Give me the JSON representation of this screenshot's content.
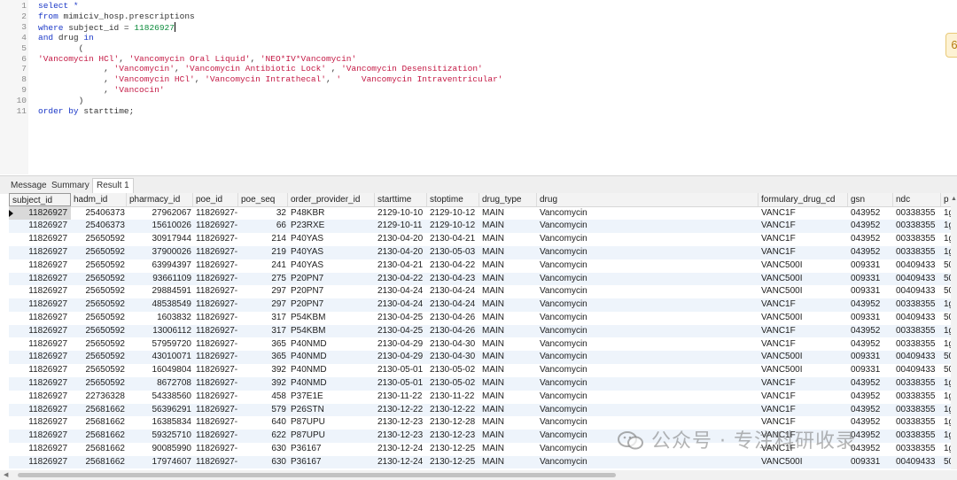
{
  "editor": {
    "line_numbers": [
      "1",
      "2",
      "3",
      "4",
      "5",
      "6",
      "7",
      "8",
      "9",
      "10",
      "11"
    ],
    "lines": [
      [
        {
          "t": "select *",
          "c": "kw"
        }
      ],
      [
        {
          "t": "from ",
          "c": "kw"
        },
        {
          "t": "mimiciv_hosp.prescriptions",
          "c": ""
        }
      ],
      [
        {
          "t": "where ",
          "c": "kw"
        },
        {
          "t": "subject_id = ",
          "c": ""
        },
        {
          "t": "11826927",
          "c": "num"
        }
      ],
      [
        {
          "t": "and ",
          "c": "kw"
        },
        {
          "t": "drug ",
          "c": ""
        },
        {
          "t": "in",
          "c": "kw"
        }
      ],
      [
        {
          "t": "        (",
          "c": ""
        }
      ],
      [
        {
          "t": "'Vancomycin HCl'",
          "c": "str"
        },
        {
          "t": ", ",
          "c": ""
        },
        {
          "t": "'Vancomycin Oral Liquid'",
          "c": "str"
        },
        {
          "t": ", ",
          "c": ""
        },
        {
          "t": "'NEO*IV*Vancomycin'",
          "c": "str"
        }
      ],
      [
        {
          "t": "             , ",
          "c": ""
        },
        {
          "t": "'Vancomycin'",
          "c": "str"
        },
        {
          "t": ", ",
          "c": ""
        },
        {
          "t": "'Vancomycin Antibiotic Lock'",
          "c": "str"
        },
        {
          "t": " , ",
          "c": ""
        },
        {
          "t": "'Vancomycin Desensitization'",
          "c": "str"
        }
      ],
      [
        {
          "t": "             , ",
          "c": ""
        },
        {
          "t": "'Vancomycin HCl'",
          "c": "str"
        },
        {
          "t": ", ",
          "c": ""
        },
        {
          "t": "'Vancomycin Intrathecal'",
          "c": "str"
        },
        {
          "t": ", ",
          "c": ""
        },
        {
          "t": "'    Vancomycin Intraventricular'",
          "c": "str"
        }
      ],
      [
        {
          "t": "             , ",
          "c": ""
        },
        {
          "t": "'Vancocin'",
          "c": "str"
        }
      ],
      [
        {
          "t": "        )",
          "c": ""
        }
      ],
      [
        {
          "t": "order by ",
          "c": "kw"
        },
        {
          "t": "starttime;",
          "c": ""
        }
      ]
    ],
    "side_badge": "6"
  },
  "tabs": [
    {
      "label": "Message",
      "active": false
    },
    {
      "label": "Summary",
      "active": false
    },
    {
      "label": "Result 1",
      "active": true
    }
  ],
  "grid": {
    "columns": [
      "subject_id",
      "hadm_id",
      "pharmacy_id",
      "poe_id",
      "poe_seq",
      "order_provider_id",
      "starttime",
      "stoptime",
      "drug_type",
      "drug",
      "formulary_drug_cd",
      "gsn",
      "ndc",
      "p"
    ],
    "rows": [
      [
        "11826927",
        "25406373",
        "27962067",
        "11826927-",
        "32",
        "P48KBR",
        "2129-10-10",
        "2129-10-12",
        "MAIN",
        "Vancomycin",
        "VANC1F",
        "043952",
        "00338355",
        "1g"
      ],
      [
        "11826927",
        "25406373",
        "15610026",
        "11826927-",
        "66",
        "P23RXE",
        "2129-10-11",
        "2129-10-12",
        "MAIN",
        "Vancomycin",
        "VANC1F",
        "043952",
        "00338355",
        "1g"
      ],
      [
        "11826927",
        "25650592",
        "30917944",
        "11826927-",
        "214",
        "P40YAS",
        "2130-04-20",
        "2130-04-21",
        "MAIN",
        "Vancomycin",
        "VANC1F",
        "043952",
        "00338355",
        "1g"
      ],
      [
        "11826927",
        "25650592",
        "37900026",
        "11826927-",
        "219",
        "P40YAS",
        "2130-04-20",
        "2130-05-03",
        "MAIN",
        "Vancomycin",
        "VANC1F",
        "043952",
        "00338355",
        "1g"
      ],
      [
        "11826927",
        "25650592",
        "63994397",
        "11826927-",
        "241",
        "P40YAS",
        "2130-04-21",
        "2130-04-22",
        "MAIN",
        "Vancomycin",
        "VANC500I",
        "009331",
        "00409433",
        "50"
      ],
      [
        "11826927",
        "25650592",
        "93661109",
        "11826927-",
        "275",
        "P20PN7",
        "2130-04-22",
        "2130-04-23",
        "MAIN",
        "Vancomycin",
        "VANC500I",
        "009331",
        "00409433",
        "50"
      ],
      [
        "11826927",
        "25650592",
        "29884591",
        "11826927-",
        "297",
        "P20PN7",
        "2130-04-24",
        "2130-04-24",
        "MAIN",
        "Vancomycin",
        "VANC500I",
        "009331",
        "00409433",
        "50"
      ],
      [
        "11826927",
        "25650592",
        "48538549",
        "11826927-",
        "297",
        "P20PN7",
        "2130-04-24",
        "2130-04-24",
        "MAIN",
        "Vancomycin",
        "VANC1F",
        "043952",
        "00338355",
        "1g"
      ],
      [
        "11826927",
        "25650592",
        "1603832",
        "11826927-",
        "317",
        "P54KBM",
        "2130-04-25",
        "2130-04-26",
        "MAIN",
        "Vancomycin",
        "VANC500I",
        "009331",
        "00409433",
        "50"
      ],
      [
        "11826927",
        "25650592",
        "13006112",
        "11826927-",
        "317",
        "P54KBM",
        "2130-04-25",
        "2130-04-26",
        "MAIN",
        "Vancomycin",
        "VANC1F",
        "043952",
        "00338355",
        "1g"
      ],
      [
        "11826927",
        "25650592",
        "57959720",
        "11826927-",
        "365",
        "P40NMD",
        "2130-04-29",
        "2130-04-30",
        "MAIN",
        "Vancomycin",
        "VANC1F",
        "043952",
        "00338355",
        "1g"
      ],
      [
        "11826927",
        "25650592",
        "43010071",
        "11826927-",
        "365",
        "P40NMD",
        "2130-04-29",
        "2130-04-30",
        "MAIN",
        "Vancomycin",
        "VANC500I",
        "009331",
        "00409433",
        "50"
      ],
      [
        "11826927",
        "25650592",
        "16049804",
        "11826927-",
        "392",
        "P40NMD",
        "2130-05-01",
        "2130-05-02",
        "MAIN",
        "Vancomycin",
        "VANC500I",
        "009331",
        "00409433",
        "50"
      ],
      [
        "11826927",
        "25650592",
        "8672708",
        "11826927-",
        "392",
        "P40NMD",
        "2130-05-01",
        "2130-05-02",
        "MAIN",
        "Vancomycin",
        "VANC1F",
        "043952",
        "00338355",
        "1g"
      ],
      [
        "11826927",
        "22736328",
        "54338560",
        "11826927-",
        "458",
        "P37E1E",
        "2130-11-22",
        "2130-11-22",
        "MAIN",
        "Vancomycin",
        "VANC1F",
        "043952",
        "00338355",
        "1g"
      ],
      [
        "11826927",
        "25681662",
        "56396291",
        "11826927-",
        "579",
        "P26STN",
        "2130-12-22",
        "2130-12-22",
        "MAIN",
        "Vancomycin",
        "VANC1F",
        "043952",
        "00338355",
        "1g"
      ],
      [
        "11826927",
        "25681662",
        "16385834",
        "11826927-",
        "640",
        "P87UPU",
        "2130-12-23",
        "2130-12-28",
        "MAIN",
        "Vancomycin",
        "VANC1F",
        "043952",
        "00338355",
        "1g"
      ],
      [
        "11826927",
        "25681662",
        "59325710",
        "11826927-",
        "622",
        "P87UPU",
        "2130-12-23",
        "2130-12-23",
        "MAIN",
        "Vancomycin",
        "VANC1F",
        "043952",
        "00338355",
        "1g"
      ],
      [
        "11826927",
        "25681662",
        "90085990",
        "11826927-",
        "630",
        "P36167",
        "2130-12-24",
        "2130-12-25",
        "MAIN",
        "Vancomycin",
        "VANC1F",
        "043952",
        "00338355",
        "1g"
      ],
      [
        "11826927",
        "25681662",
        "17974607",
        "11826927-",
        "630",
        "P36167",
        "2130-12-24",
        "2130-12-25",
        "MAIN",
        "Vancomycin",
        "VANC500I",
        "009331",
        "00409433",
        "50"
      ]
    ]
  },
  "watermark": "公众号 · 专注科研收录"
}
